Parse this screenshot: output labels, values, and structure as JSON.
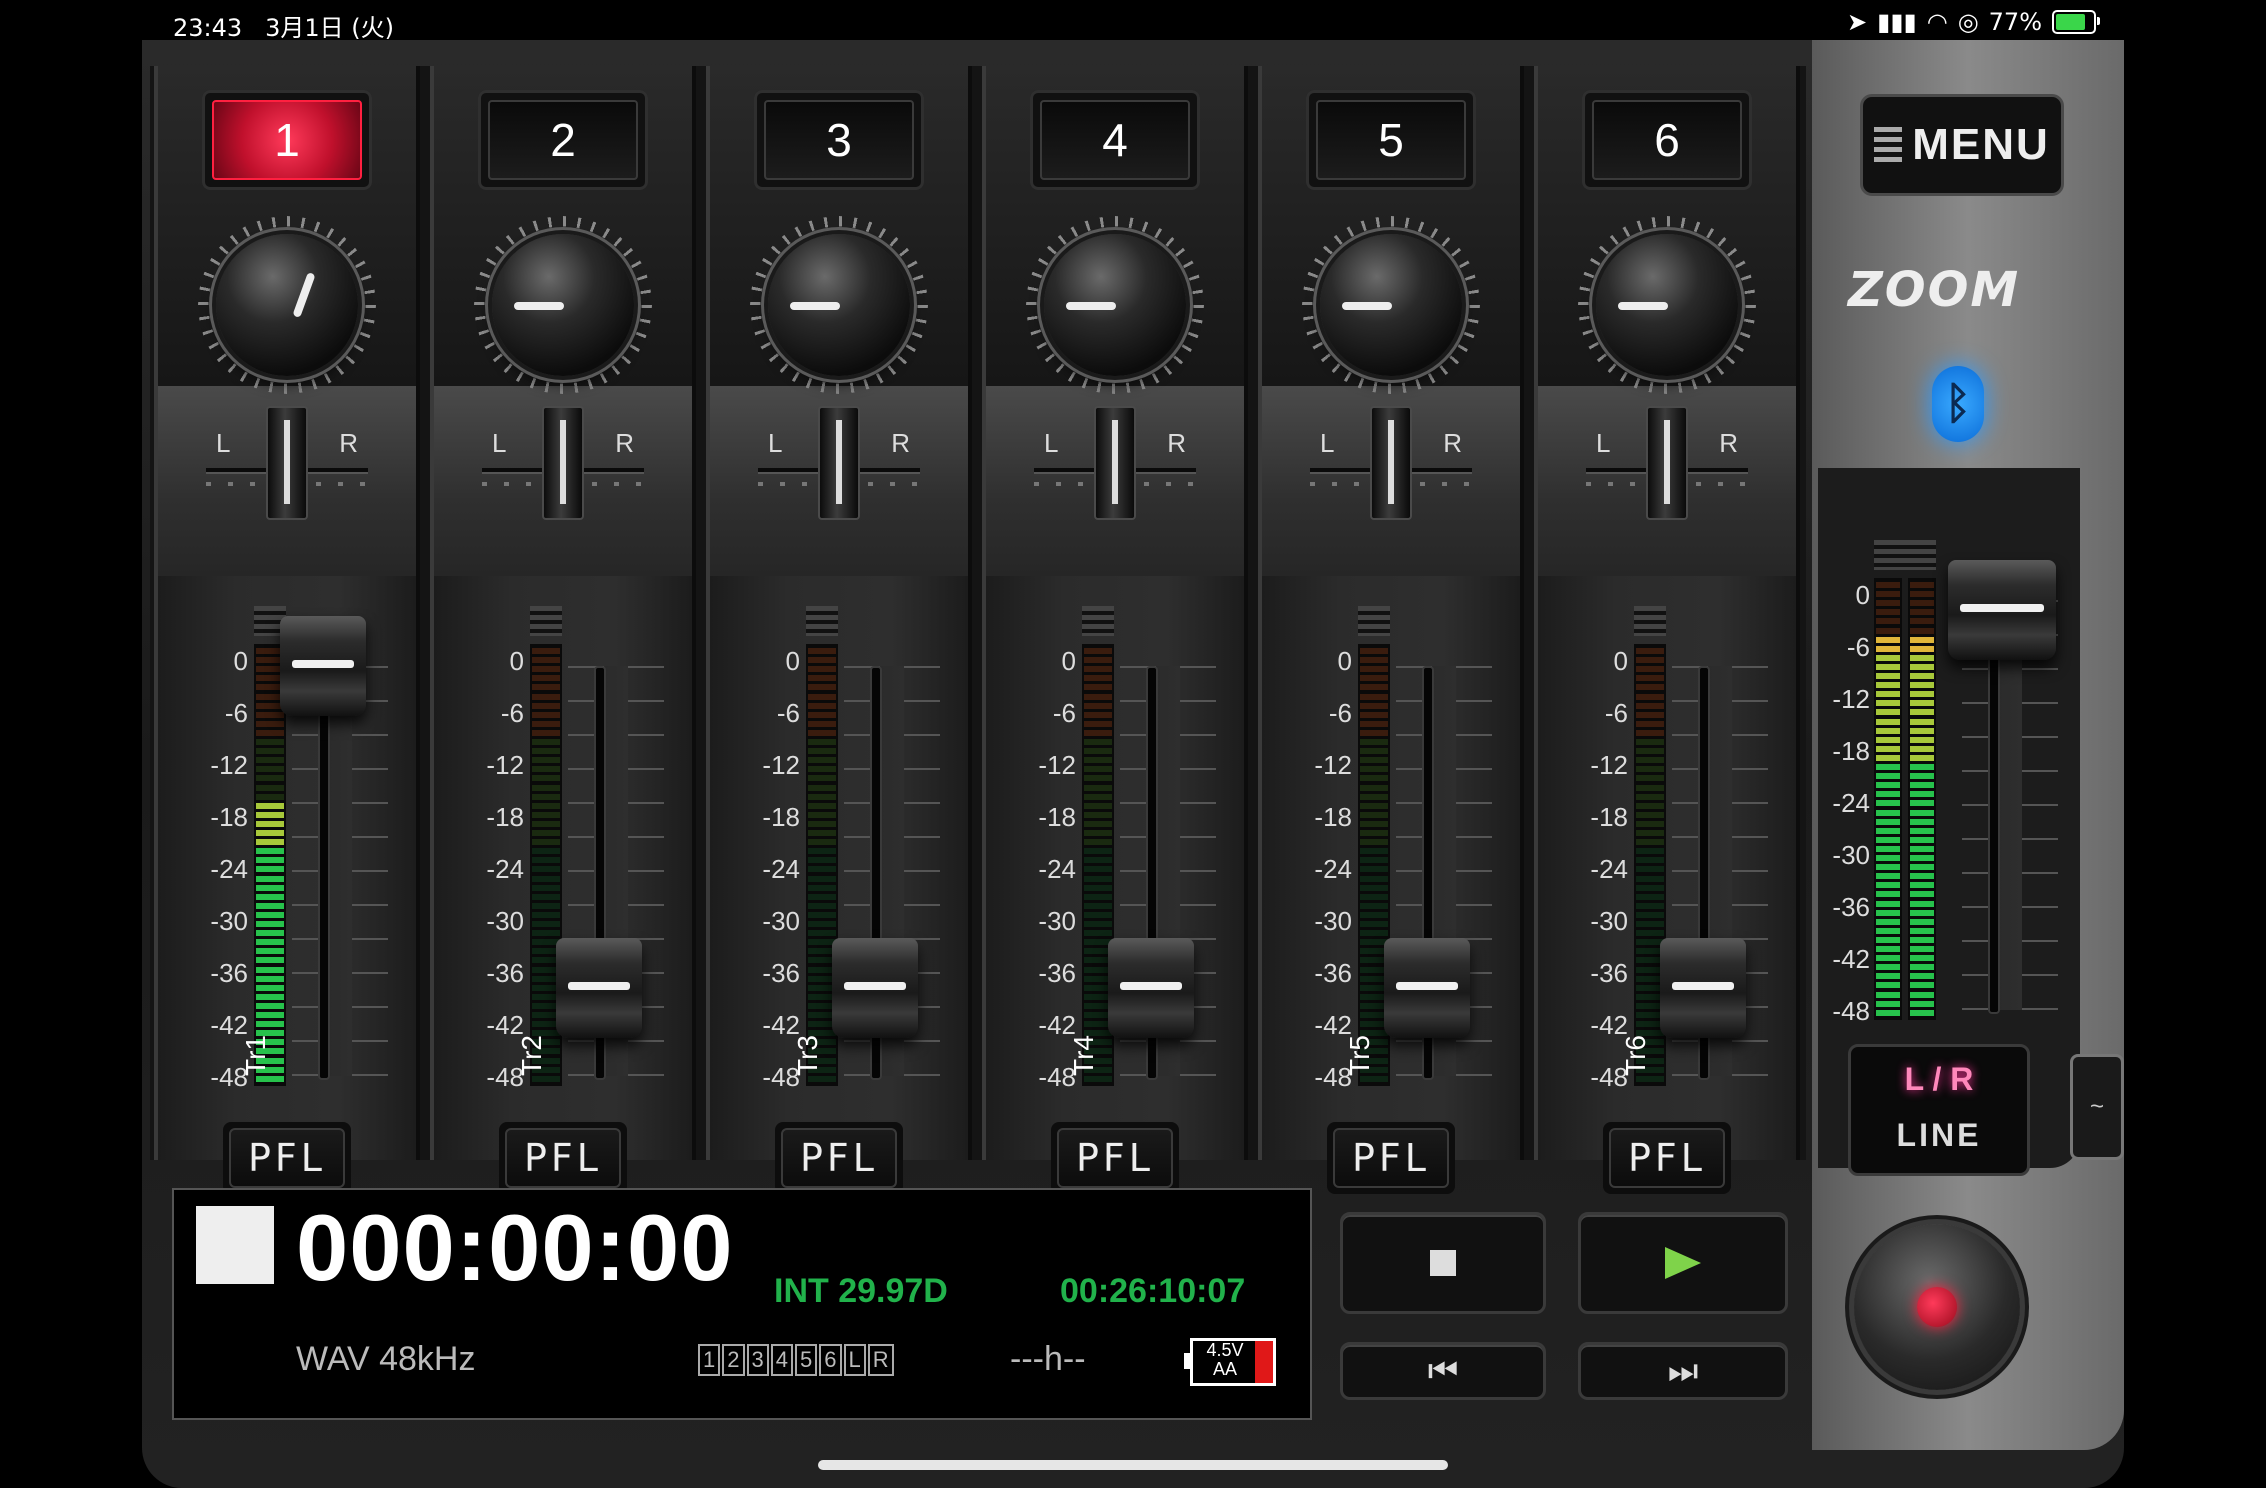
{
  "status": {
    "time": "23:43",
    "date": "3月1日 (火)",
    "battery": "77%",
    "battery_level": 0.77
  },
  "channels": [
    {
      "number": "1",
      "track": "Tr1",
      "active": true
    },
    {
      "number": "2",
      "track": "Tr2",
      "active": false
    },
    {
      "number": "3",
      "track": "Tr3",
      "active": false
    },
    {
      "number": "4",
      "track": "Tr4",
      "active": false
    },
    {
      "number": "5",
      "track": "Tr5",
      "active": false
    },
    {
      "number": "6",
      "track": "Tr6",
      "active": false
    }
  ],
  "pan": {
    "left": "L",
    "right": "R"
  },
  "scale": [
    "0",
    "-6",
    "-12",
    "-18",
    "-24",
    "-30",
    "-36",
    "-42",
    "-48"
  ],
  "pfl_label": "PFL",
  "right_panel": {
    "menu_label": "MENU",
    "brand": "ZOOM",
    "bluetooth_icon": "bluetooth-icon",
    "lr_top": "L / R",
    "lr_bottom": "LINE",
    "side_tab": "~"
  },
  "display": {
    "counter": "000:00:00",
    "frame_rate": "INT 29.97D",
    "timecode": "00:26:10:07",
    "format": "WAV 48kHz",
    "track_indicators": [
      "1",
      "2",
      "3",
      "4",
      "5",
      "6",
      "L",
      "R"
    ],
    "remaining": "---h--",
    "battery_voltage": "4.5V",
    "battery_type": "AA"
  },
  "transport": {
    "stop_icon": "stop-icon",
    "play_icon": "play-icon",
    "rewind": "⏮",
    "forward": "⏭",
    "record_icon": "record-icon"
  },
  "colors": {
    "meter_green": "#27c24c",
    "meter_yellow": "#e0b63a",
    "active_red": "#e0102c",
    "timecode_green": "#21b24b"
  }
}
